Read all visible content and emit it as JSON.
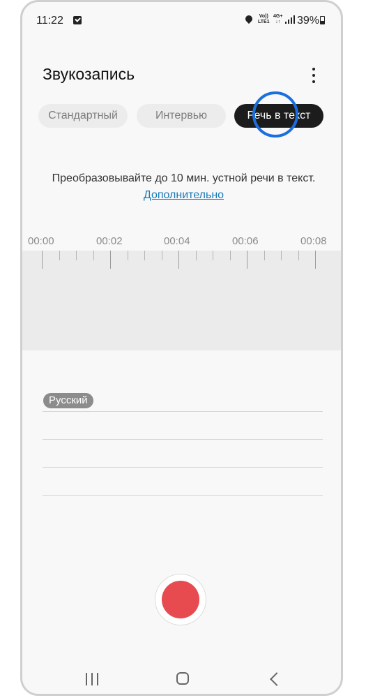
{
  "status_bar": {
    "time": "11:22",
    "volte_line1": "Vo))",
    "volte_line2": "LTE1",
    "network_line1": "4G+",
    "network_line2": "↓↑",
    "battery": "39%"
  },
  "header": {
    "title": "Звукозапись",
    "more_icon": "more-vertical-icon"
  },
  "tabs": [
    {
      "label": "Стандартный",
      "active": false
    },
    {
      "label": "Интервью",
      "active": false
    },
    {
      "label": "Речь в текст",
      "active": true
    }
  ],
  "info": {
    "text": "Преобразовывайте до 10 мин. устной речи в текст.",
    "link": "Дополнительно"
  },
  "timeline": {
    "labels": [
      "00:00",
      "00:02",
      "00:04",
      "00:06",
      "00:08"
    ]
  },
  "language_badge": "Русский",
  "record_button": "record-icon",
  "colors": {
    "accent_ring": "#1a6fde",
    "record": "#e84b4f",
    "active_tab": "#1c1c1c"
  }
}
